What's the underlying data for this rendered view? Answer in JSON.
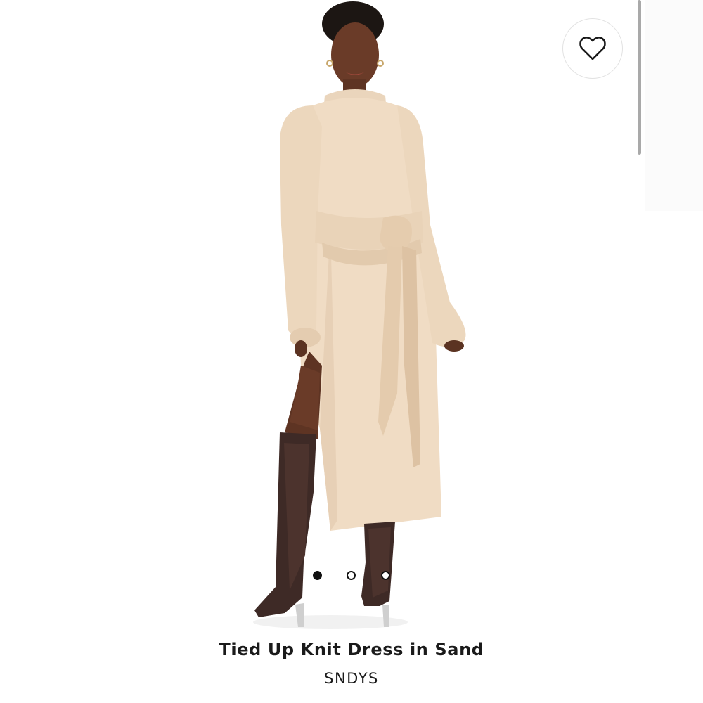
{
  "product": {
    "title": "Tied Up Knit Dress in Sand",
    "brand": "SNDYS"
  },
  "favorite_button": {
    "icon": "heart-outline-icon"
  },
  "carousel": {
    "total_images": 3,
    "active_index": 0
  },
  "colors": {
    "dress": "#f0dcc4",
    "boots": "#3e2a26",
    "text": "#1a1a1a"
  }
}
